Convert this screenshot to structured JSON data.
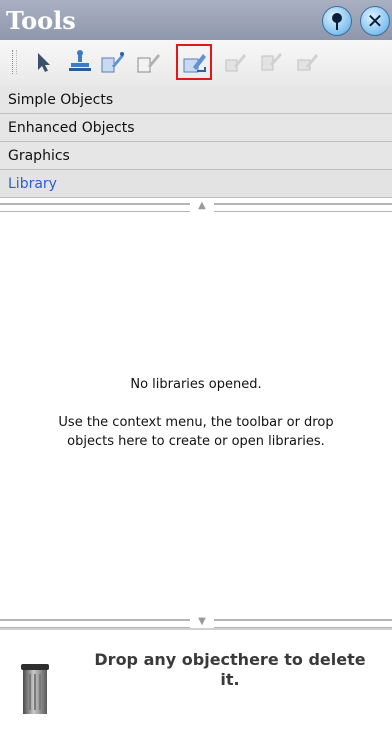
{
  "panel": {
    "title": "Tools"
  },
  "titlebar": {
    "pin_icon": "pin-icon",
    "close_icon": "close-icon",
    "close_glyph": "✕"
  },
  "toolbar": {
    "tools": [
      {
        "name": "pointer-tool-icon",
        "enabled": true
      },
      {
        "name": "stamp-tool-icon",
        "enabled": true
      },
      {
        "name": "new-library-icon",
        "enabled": true
      },
      {
        "name": "open-library-icon",
        "enabled": true
      },
      {
        "name": "add-to-library-icon",
        "enabled": true,
        "selected": true
      },
      {
        "name": "library-tool-6-icon",
        "enabled": false
      },
      {
        "name": "library-tool-7-icon",
        "enabled": false
      },
      {
        "name": "library-tool-8-icon",
        "enabled": false
      }
    ]
  },
  "sections": {
    "simple_objects": "Simple Objects",
    "enhanced_objects": "Enhanced Objects",
    "graphics": "Graphics",
    "library": "Library"
  },
  "library_content": {
    "empty_title": "No libraries opened.",
    "hint_line1": "Use the context menu, the toolbar or drop",
    "hint_line2": "objects here to create or open libraries."
  },
  "trash": {
    "icon": "trash-bin-icon",
    "text_line1": "Drop any objecthere to delete",
    "text_line2": "it."
  },
  "colors": {
    "active_section": "#2b5fd6",
    "selection_outline": "#e01818"
  }
}
